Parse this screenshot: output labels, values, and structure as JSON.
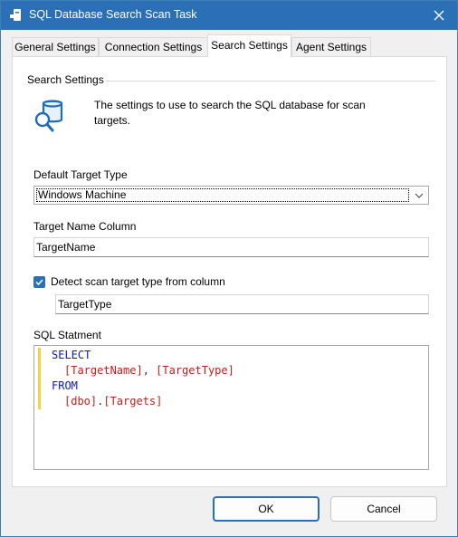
{
  "window": {
    "title": "SQL Database Search Scan Task",
    "accent": "#2b6fb6"
  },
  "tabs": [
    {
      "label": "General Settings",
      "active": false
    },
    {
      "label": "Connection Settings",
      "active": false
    },
    {
      "label": "Search Settings",
      "active": true
    },
    {
      "label": "Agent Settings",
      "active": false
    }
  ],
  "section": {
    "title": "Search Settings",
    "icon": "database-search-icon",
    "description": "The settings to use to search the SQL database for scan targets."
  },
  "target_type": {
    "label": "Default Target Type",
    "value": "Windows Machine"
  },
  "target_name": {
    "label": "Target Name Column",
    "value": "TargetName"
  },
  "detect": {
    "label": "Detect scan target type from column",
    "checked": true,
    "column_value": "TargetType"
  },
  "sql": {
    "label": "SQL Statment",
    "lines": [
      {
        "keyword": "SELECT"
      },
      {
        "col1": "[TargetName]",
        "sep": ", ",
        "col2": "[TargetType]"
      },
      {
        "keyword": "FROM"
      },
      {
        "schema": "[dbo]",
        "dot": ".",
        "table": "[Targets]"
      }
    ],
    "colors": {
      "keyword": "#1010e0",
      "identifier": "#c0201a",
      "gutter": "#f7d23e"
    }
  },
  "buttons": {
    "ok": "OK",
    "cancel": "Cancel"
  }
}
